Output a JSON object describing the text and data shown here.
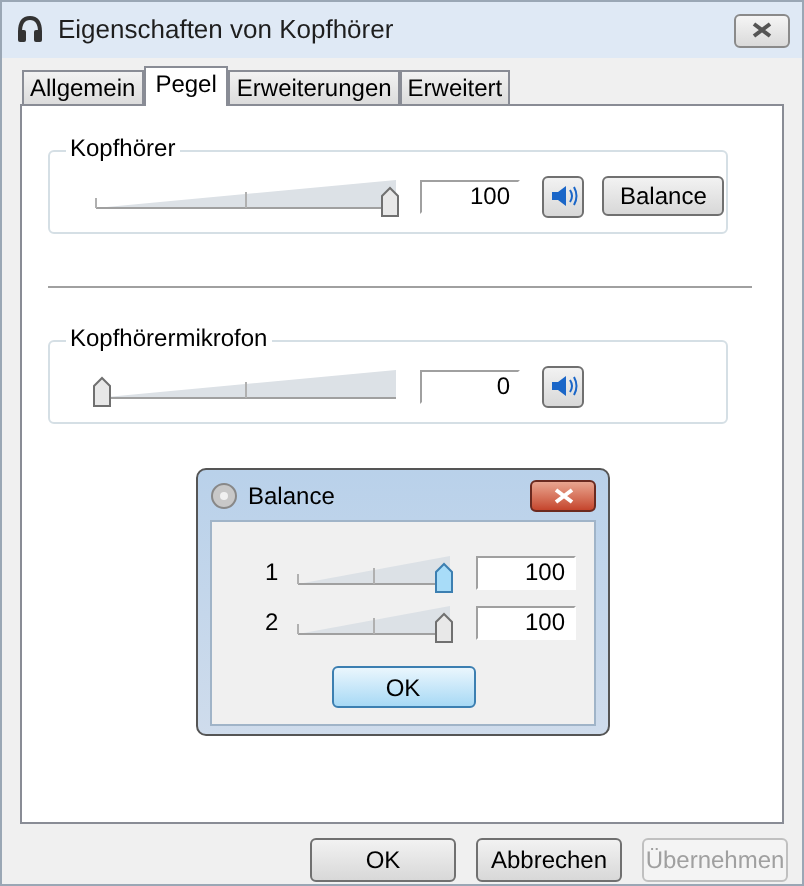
{
  "window": {
    "title": "Eigenschaften von Kopfhörer"
  },
  "tabs": [
    {
      "label": "Allgemein",
      "selected": false
    },
    {
      "label": "Pegel",
      "selected": true
    },
    {
      "label": "Erweiterungen",
      "selected": false
    },
    {
      "label": "Erweitert",
      "selected": false
    }
  ],
  "groups": [
    {
      "label": "Kopfhörer",
      "level": 1,
      "value": "100",
      "button": "Balance"
    },
    {
      "label": "Kopfhörermikrofon",
      "level": 0,
      "value": "0"
    }
  ],
  "balance_dialog": {
    "title": "Balance",
    "channels": [
      {
        "label": "1",
        "level": 1,
        "value": "100",
        "selected": true
      },
      {
        "label": "2",
        "level": 1,
        "value": "100",
        "selected": false
      }
    ],
    "ok": "OK"
  },
  "buttons": [
    {
      "label": "OK",
      "disabled": false
    },
    {
      "label": "Abbrechen",
      "disabled": false
    },
    {
      "label": "Übernehmen",
      "disabled": true
    }
  ]
}
